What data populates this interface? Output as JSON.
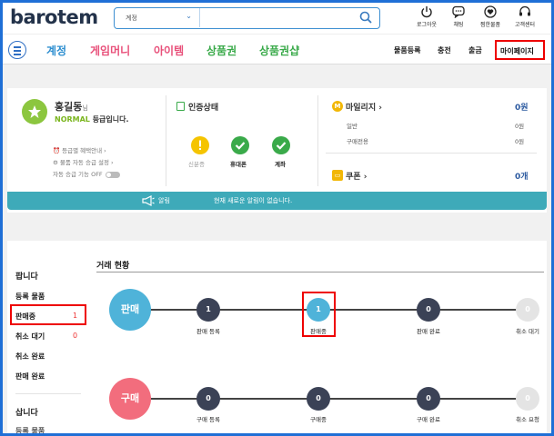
{
  "header": {
    "logo": "barotem",
    "search_category": "계정",
    "icons": [
      {
        "name": "logout",
        "label": "로그아웃"
      },
      {
        "name": "chat",
        "label": "채팅"
      },
      {
        "name": "wishlist",
        "label": "찜한물품"
      },
      {
        "name": "support",
        "label": "고객센터"
      }
    ]
  },
  "nav": {
    "items": [
      {
        "label": "계정",
        "color": "#2f8fd0"
      },
      {
        "label": "게임머니",
        "color": "#e8507a"
      },
      {
        "label": "아이템",
        "color": "#e8507a"
      },
      {
        "label": "상품권",
        "color": "#3aaa4a"
      },
      {
        "label": "상품권샵",
        "color": "#3aaa4a"
      }
    ],
    "right": [
      "물품등록",
      "충전",
      "출금"
    ],
    "mypage": "마이페이지"
  },
  "profile": {
    "name": "홍길동",
    "suffix": "님",
    "grade": "NORMAL",
    "grade_text": " 등급입니다.",
    "links": [
      "등급별 혜택안내 ›",
      "물품 자동 승급 설정 ›",
      "자동 승급 기능 OFF"
    ]
  },
  "verification": {
    "title": "인증상태",
    "items": [
      {
        "label": "신분증",
        "status": "warning"
      },
      {
        "label": "휴대폰",
        "status": "ok"
      },
      {
        "label": "계좌",
        "status": "ok"
      }
    ]
  },
  "mileage": {
    "title": "마일리지 ›",
    "total": "0원",
    "rows": [
      {
        "label": "일반",
        "value": "0원"
      },
      {
        "label": "구매전용",
        "value": "0원"
      }
    ]
  },
  "coupon": {
    "title": "쿠폰 ›",
    "count": "0개"
  },
  "alert": {
    "label": "알림",
    "message": "현재 새로운 알림이 없습니다."
  },
  "sidebar": {
    "sell_header": "팝니다",
    "sell_items": [
      {
        "label": "등록 물품",
        "count": ""
      },
      {
        "label": "판매중",
        "count": "1"
      },
      {
        "label": "취소 대기",
        "count": "0"
      },
      {
        "label": "취소 완료",
        "count": ""
      },
      {
        "label": "판매 완료",
        "count": ""
      }
    ],
    "buy_header": "삽니다",
    "buy_items": [
      {
        "label": "등록 물품"
      }
    ]
  },
  "trade": {
    "title": "거래 현황",
    "sell": {
      "label": "판매",
      "steps": [
        {
          "label": "판매 등록",
          "count": "1"
        },
        {
          "label": "판매중",
          "count": "1"
        },
        {
          "label": "판매 완료",
          "count": "0"
        }
      ],
      "cancel": {
        "label": "취소 대기",
        "count": "0"
      }
    },
    "buy": {
      "label": "구매",
      "steps": [
        {
          "label": "구매 등록",
          "count": "0"
        },
        {
          "label": "구매중",
          "count": "0"
        },
        {
          "label": "구매 완료",
          "count": "0"
        }
      ],
      "cancel": {
        "label": "취소 요청",
        "count": "0"
      }
    }
  },
  "colors": {
    "brand": "#2f6fc4",
    "teal": "#3eaab9",
    "sell": "#4fb3d9",
    "buy": "#f26d7d",
    "node": "#3b4256",
    "green": "#3aaa4a"
  }
}
